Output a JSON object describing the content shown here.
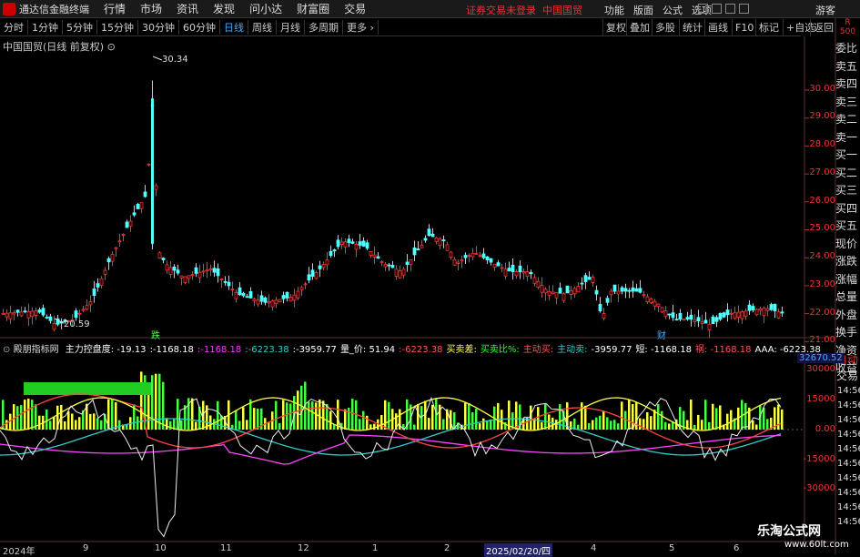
{
  "topbar": {
    "app_title": "通达信金融终端",
    "menu": [
      "行情",
      "市场",
      "资讯",
      "发现",
      "问小达",
      "财富圈",
      "交易"
    ],
    "notice": "证券交易未登录",
    "stock_name": "中国国贸",
    "right_menu": [
      "功能",
      "版面",
      "公式",
      "选项"
    ],
    "user": "游客"
  },
  "toolbar": {
    "periods": [
      "分时",
      "1分钟",
      "5分钟",
      "15分钟",
      "30分钟",
      "60分钟",
      "日线",
      "周线",
      "月线",
      "多周期",
      "更多"
    ],
    "active_period": "日线",
    "right_buttons": [
      "复权",
      "叠加",
      "多股",
      "统计",
      "画线",
      "F10",
      "标记",
      "+自选",
      "返回"
    ]
  },
  "chart": {
    "title": "中国国贸(日线 前复权)",
    "high_label": "30.34",
    "low_label": "20.59",
    "price_axis": [
      "30.00",
      "29.00",
      "28.00",
      "27.00",
      "26.00",
      "25.00",
      "24.00",
      "23.00",
      "22.00",
      "21.00"
    ],
    "event_markers": [
      "跌",
      "财"
    ]
  },
  "side_panel": [
    "委比",
    "卖五",
    "卖四",
    "卖三",
    "卖二",
    "卖一",
    "买一",
    "买二",
    "买三",
    "买四",
    "买五",
    "现价",
    "涨跌",
    "涨幅",
    "总量",
    "外盘",
    "换手",
    "净资",
    "收益"
  ],
  "side_panel_extra": [
    "自动",
    "交易"
  ],
  "side_r_label": "R",
  "side_500": "500",
  "indicator": {
    "name": "殿朋指标网",
    "items": [
      {
        "text": "主力控盘度: -19.13",
        "color": "#ffffff"
      },
      {
        "text": ":-1168.18",
        "color": "#ffffff"
      },
      {
        "text": ":-1168.18",
        "color": "#ff33ff"
      },
      {
        "text": ":-6223.38",
        "color": "#33cccc"
      },
      {
        "text": ":-3959.77",
        "color": "#ffffff"
      },
      {
        "text": "量_价: 51.94",
        "color": "#ffffff"
      },
      {
        "text": ":-6223.38",
        "color": "#ff5555"
      },
      {
        "text": "买卖差:",
        "color": "#ffff55"
      },
      {
        "text": "买卖比%:",
        "color": "#33ff33"
      },
      {
        "text": "主动买:",
        "color": "#ff5555"
      },
      {
        "text": "主动卖:",
        "color": "#33cccc"
      },
      {
        "text": "-3959.77",
        "color": "#ffffff"
      },
      {
        "text": "短: -1168.18",
        "color": "#ffffff"
      },
      {
        "text": "祸: -1168.18",
        "color": "#ff5555"
      },
      {
        "text": "AAA: -6223.38",
        "color": "#ffffff"
      }
    ],
    "top_value": "32670.52",
    "scale": [
      "30000",
      "15000",
      "0.00",
      "-15000",
      "-30000"
    ],
    "times": [
      "14:56",
      "14:56",
      "14:56",
      "14:56",
      "14:56",
      "14:56",
      "14:56",
      "14:56",
      "14:56",
      "14:56"
    ]
  },
  "dates": [
    "2024年",
    "9",
    "10",
    "11",
    "12",
    "1",
    "2",
    "2025/02/20/四",
    "4",
    "5",
    "6"
  ],
  "watermark": {
    "main": "乐淘公式网",
    "sub": "www.60lt.com"
  }
}
